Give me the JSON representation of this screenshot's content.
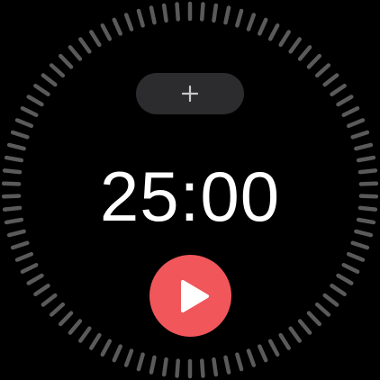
{
  "timer": {
    "display": "25:00",
    "tick_count": 90
  },
  "controls": {
    "add_icon": "plus-icon",
    "play_icon": "play-icon"
  },
  "colors": {
    "background": "#000000",
    "tick": "#5a5a5a",
    "add_button_bg": "#2c2c2e",
    "plus": "#c8c8c8",
    "accent": "#f0565a",
    "text": "#ffffff"
  }
}
